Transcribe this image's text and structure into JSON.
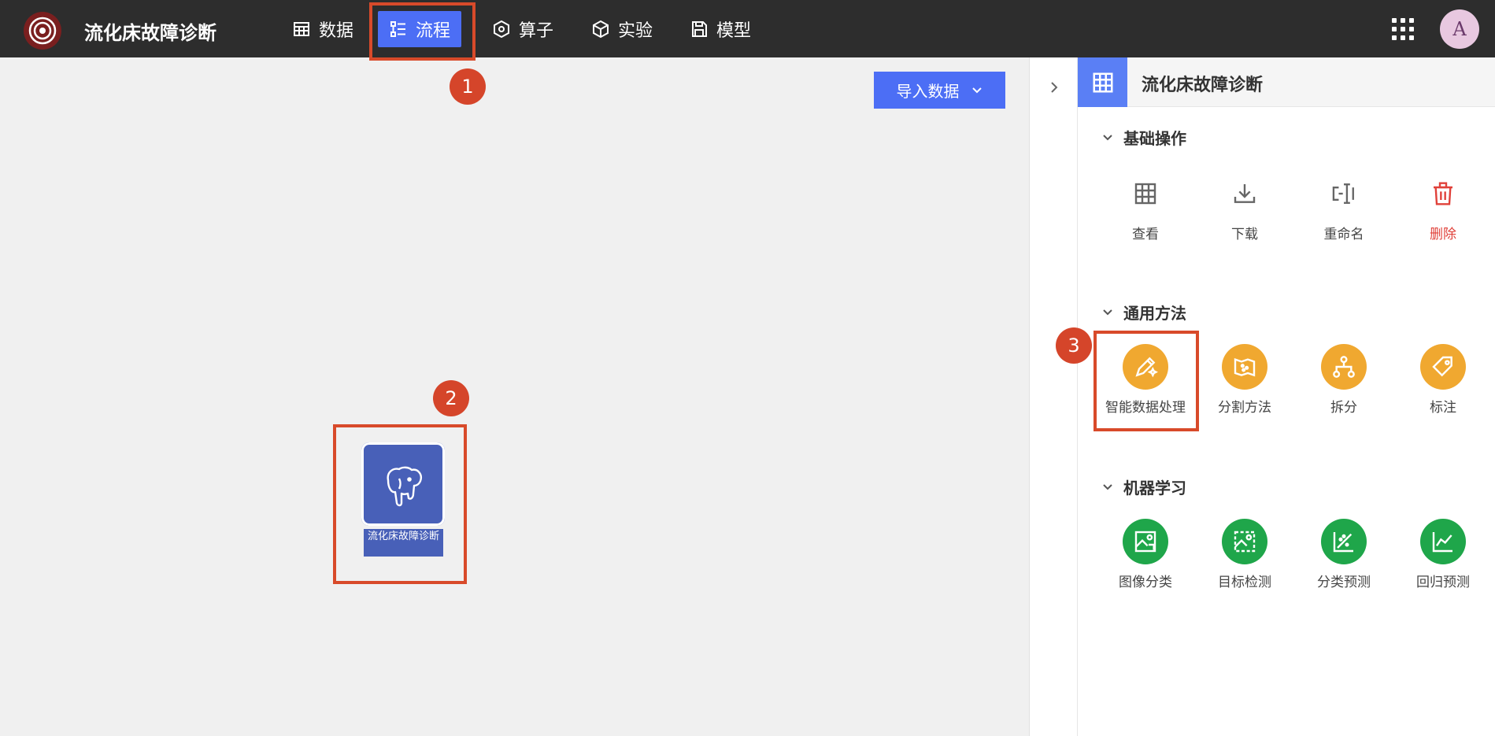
{
  "app": {
    "title": "流化床故障诊断",
    "avatar_letter": "A"
  },
  "nav": [
    {
      "label": "数据",
      "icon": "table-icon"
    },
    {
      "label": "流程",
      "icon": "flow-icon",
      "active": true
    },
    {
      "label": "算子",
      "icon": "hexagon-icon"
    },
    {
      "label": "实验",
      "icon": "cube-icon"
    },
    {
      "label": "模型",
      "icon": "save-icon"
    }
  ],
  "canvas": {
    "import_button": "导入数据",
    "node": {
      "label": "流化床故障诊断",
      "icon": "postgresql-elephant-icon"
    }
  },
  "callouts": [
    "1",
    "2",
    "3"
  ],
  "panel": {
    "title": "流化床故障诊断",
    "sections": [
      {
        "title": "基础操作",
        "items": [
          {
            "label": "查看",
            "icon": "table-icon"
          },
          {
            "label": "下载",
            "icon": "download-icon"
          },
          {
            "label": "重命名",
            "icon": "rename-icon"
          },
          {
            "label": "删除",
            "icon": "trash-icon"
          }
        ]
      },
      {
        "title": "通用方法",
        "items": [
          {
            "label": "智能数据处理",
            "icon": "magic-pen-icon"
          },
          {
            "label": "分割方法",
            "icon": "split-map-icon"
          },
          {
            "label": "拆分",
            "icon": "hierarchy-icon"
          },
          {
            "label": "标注",
            "icon": "tag-icon"
          }
        ]
      },
      {
        "title": "机器学习",
        "items": [
          {
            "label": "图像分类",
            "icon": "image-classify-icon"
          },
          {
            "label": "目标检测",
            "icon": "object-detect-icon"
          },
          {
            "label": "分类预测",
            "icon": "scatter-predict-icon"
          },
          {
            "label": "回归预测",
            "icon": "line-chart-icon"
          }
        ]
      }
    ]
  },
  "colors": {
    "accent": "#4c6ef5",
    "callout": "#d5452a",
    "orange": "#f0a830",
    "green": "#1fa64a",
    "danger": "#e0413a"
  }
}
